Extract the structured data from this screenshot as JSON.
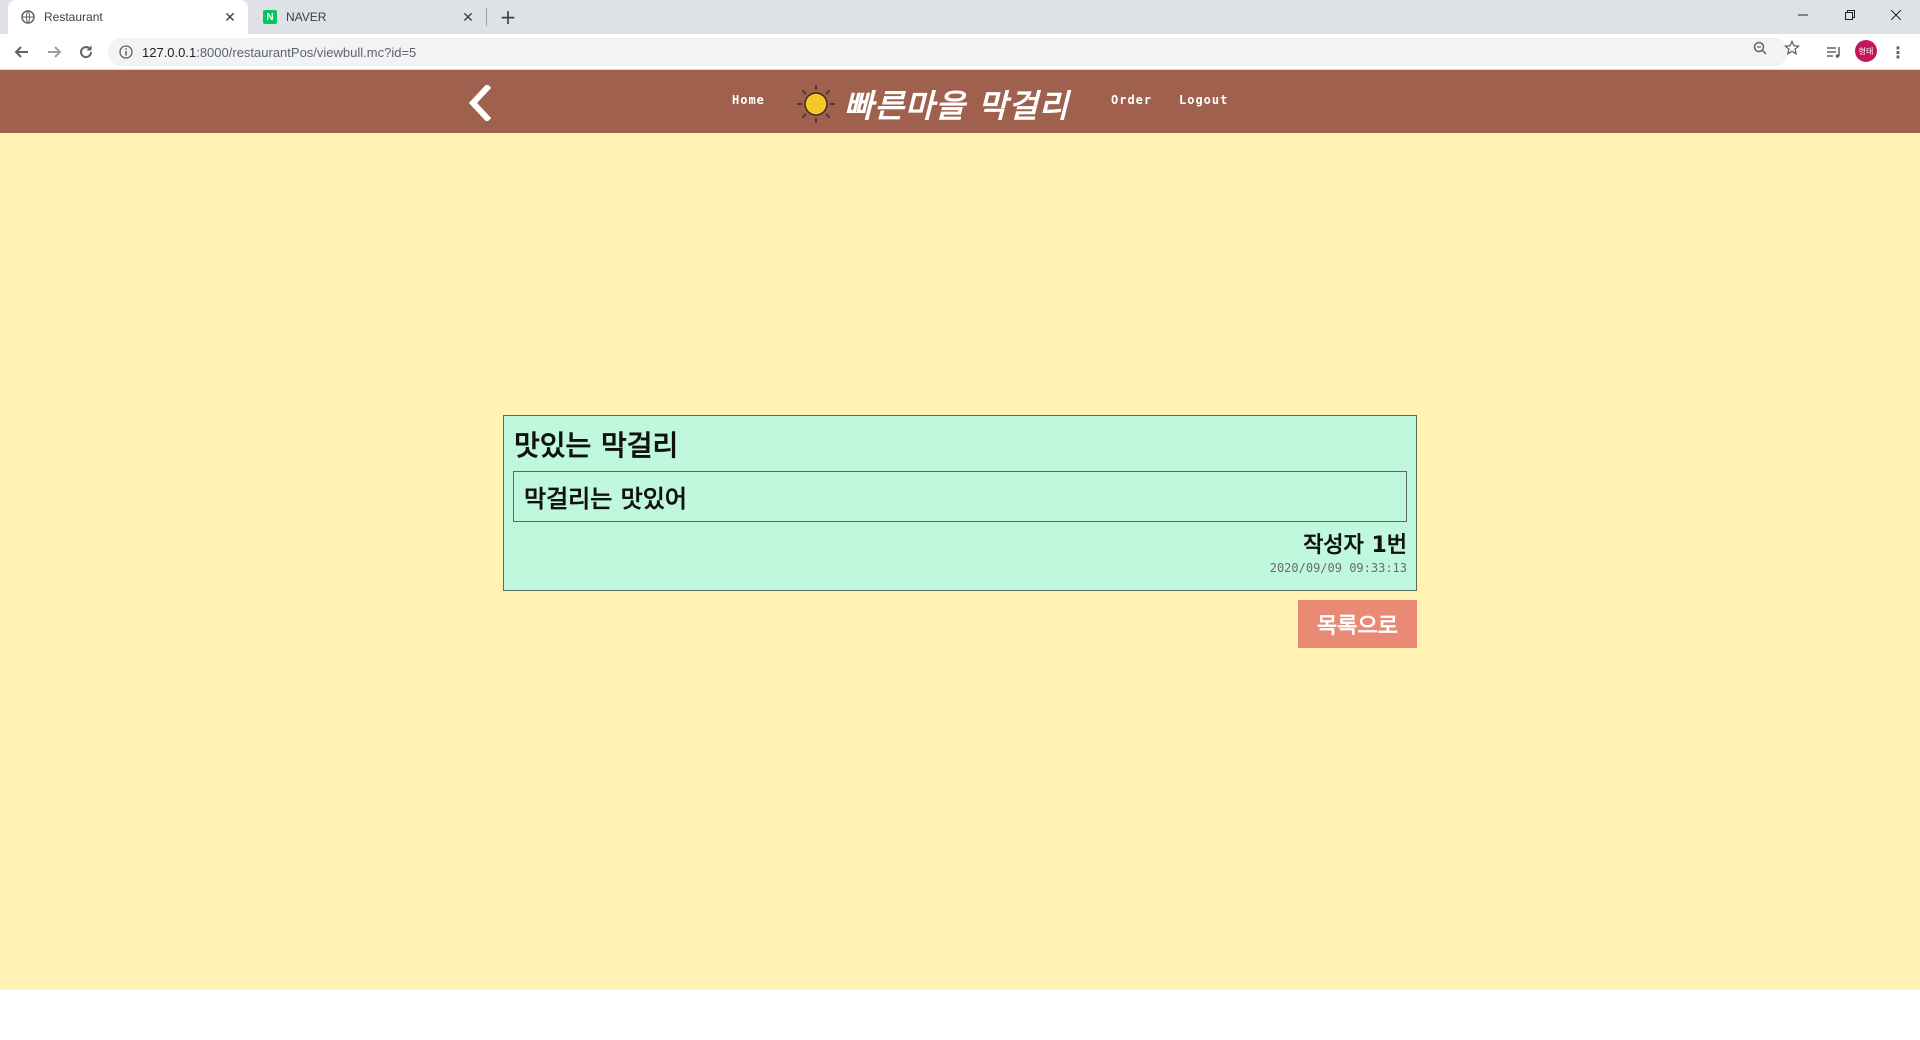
{
  "browser": {
    "tabs": [
      {
        "title": "Restaurant",
        "active": true
      },
      {
        "title": "NAVER",
        "active": false
      }
    ],
    "url": {
      "host": "127.0.0.1",
      "rest": ":8000/restaurantPos/viewbull.mc?id=5"
    },
    "profile_initials": "형태",
    "naver_favicon_letter": "N"
  },
  "header": {
    "nav_home": "Home",
    "logo_text": "빠른마을 막걸리",
    "nav_order": "Order",
    "nav_logout": "Logout",
    "bg_color": "#a0604e"
  },
  "post": {
    "title": "맛있는 막걸리",
    "content": "막걸리는 맛있어",
    "author": "작성자 1번",
    "date": "2020/09/09 09:33:13"
  },
  "actions": {
    "list_button": "목록으로"
  },
  "colors": {
    "page_bg": "#fff2b3",
    "card_bg": "#bff8dd",
    "button_bg": "#ea8a74"
  }
}
